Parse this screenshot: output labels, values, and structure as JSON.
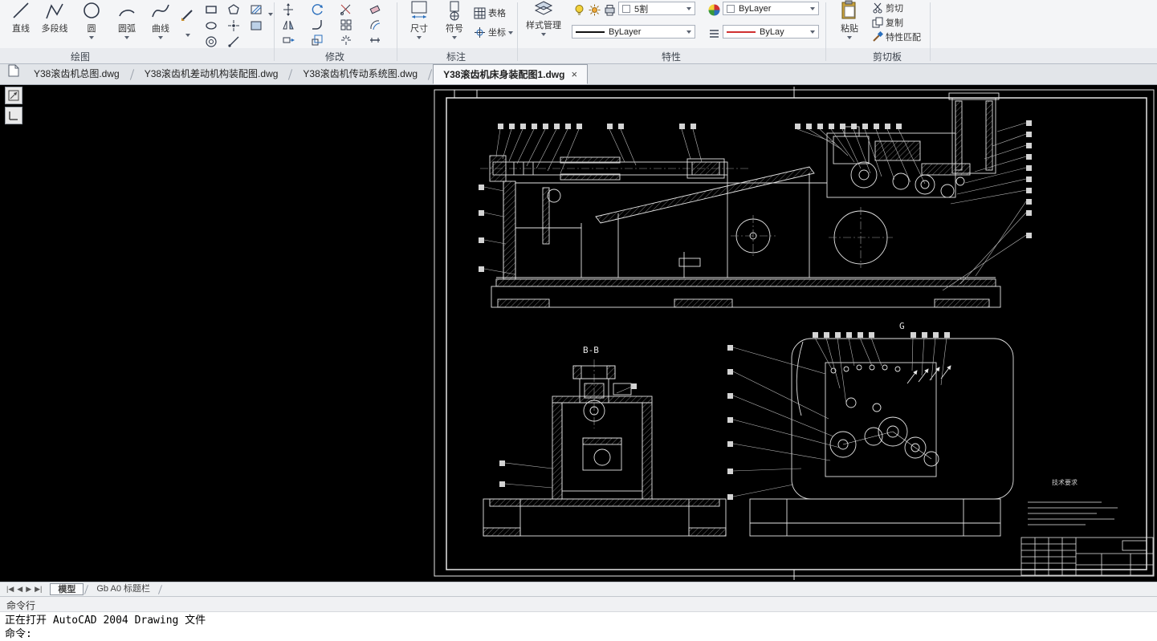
{
  "ribbon": {
    "draw": {
      "label": "绘图",
      "line": "直线",
      "polyline": "多段线",
      "circle": "圆",
      "arc": "圆弧",
      "spline": "曲线"
    },
    "modify": {
      "label": "修改"
    },
    "annotate": {
      "label": "标注",
      "dimension": "尺寸",
      "symbol": "符号",
      "table": "表格",
      "coordinate": "坐标"
    },
    "properties": {
      "label": "特性",
      "style_manager": "样式管理",
      "layer": "5割",
      "linetype": "ByLayer",
      "color": "ByLayer",
      "plot_style": "ByLay"
    },
    "clipboard": {
      "label": "剪切板",
      "paste": "粘贴",
      "cut": "剪切",
      "copy": "复制",
      "match_properties": "特性匹配"
    }
  },
  "file_tabs": [
    {
      "label": "Y38滚齿机总图.dwg"
    },
    {
      "label": "Y38滚齿机差动机构装配图.dwg"
    },
    {
      "label": "Y38滚齿机传动系统图.dwg"
    },
    {
      "label": "Y38滚齿机床身装配图1.dwg",
      "close": "×"
    }
  ],
  "drawing": {
    "view_bb": "B-B",
    "view_g": "G",
    "tech_note": "技术要求"
  },
  "layout": {
    "nav_first": "|◀",
    "nav_prev": "◀",
    "nav_next": "▶",
    "nav_last": "▶|",
    "model_tab": "模型",
    "layout_tab": "Gb A0 标题栏"
  },
  "command": {
    "title": "命令行",
    "history": "正在打开 AutoCAD 2004 Drawing 文件",
    "prompt": "命令:"
  },
  "colors": {
    "canvas_bg": "#000000",
    "line": "#e6e6e6",
    "red_sample": "#d03030"
  }
}
